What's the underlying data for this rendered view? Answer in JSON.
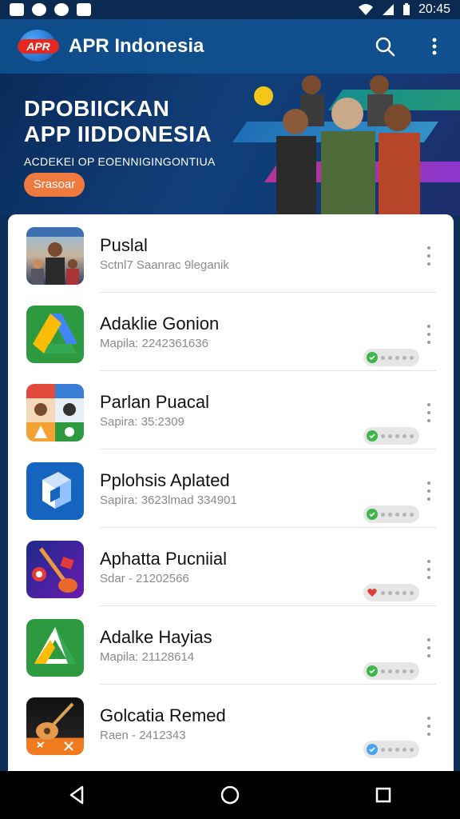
{
  "status_bar": {
    "time": "20:45"
  },
  "app_bar": {
    "logo_text": "APR",
    "title": "APR Indonesia"
  },
  "banner": {
    "title_line1": "DPOBIICKAN",
    "title_line2": "APP IIDDONESIA",
    "subtitle": "ACDEKEI OP EOENNIGINGONTIUA",
    "button_label": "Srasoar"
  },
  "apps": [
    {
      "name": "Puslal",
      "meta": "Sctnl7 Saanrac 9leganik",
      "icon": "people-photo-icon",
      "toggle": null
    },
    {
      "name": "Adaklie Gonion",
      "meta": "Mapila: 2242361636",
      "icon": "drive-triangle-icon",
      "toggle": "green"
    },
    {
      "name": "Parlan Puacal",
      "meta": "Sapira: 35:2309",
      "icon": "collage-icon",
      "toggle": "green"
    },
    {
      "name": "Pplohsis Aplated",
      "meta": "Sapira: 3623lmad 334901",
      "icon": "cube-logo-icon",
      "toggle": "green"
    },
    {
      "name": "Aphatta Pucniial",
      "meta": "Sdar - 21202566",
      "icon": "guitar-red-icon",
      "toggle": "red"
    },
    {
      "name": "Adalke Hayias",
      "meta": "Mapila: 21128614",
      "icon": "drive-triangle-green-icon",
      "toggle": "green"
    },
    {
      "name": "Golcatia Remed",
      "meta": "Raen - 2412343",
      "icon": "guitar-orange-icon",
      "toggle": "blue"
    }
  ],
  "colors": {
    "app_bar": "#0f4c8a",
    "accent_orange": "#f07a3e",
    "toggle_green": "#3fb54a",
    "toggle_red": "#e23b3b",
    "toggle_blue": "#4aa3f0"
  }
}
